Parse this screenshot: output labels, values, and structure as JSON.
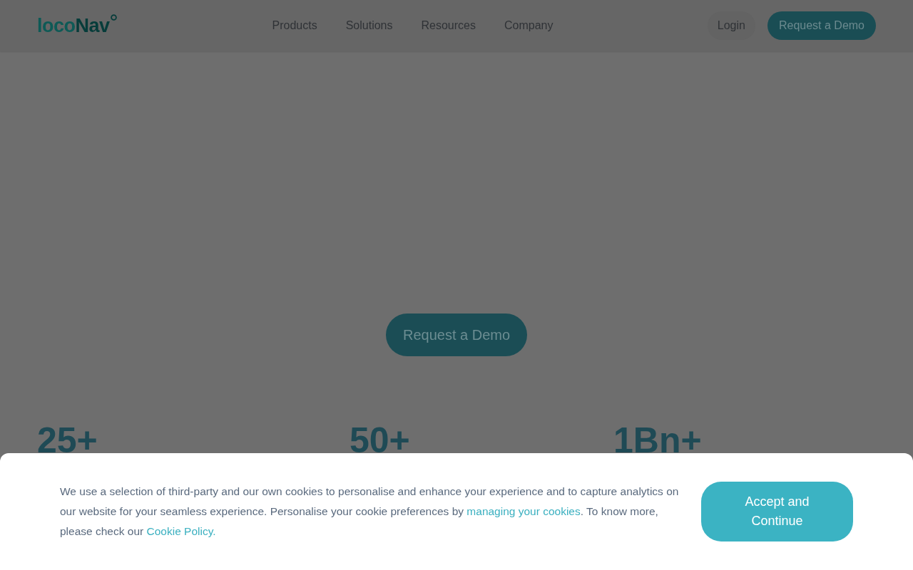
{
  "header": {
    "logo": {
      "parts": [
        "loco",
        "Nav"
      ]
    },
    "nav": [
      "Products",
      "Solutions",
      "Resources",
      "Company"
    ],
    "login": "Login",
    "demo_button": "Request a Demo"
  },
  "hero": {
    "button": "Request a Demo"
  },
  "stats": [
    "25+",
    "50+",
    "1Bn+"
  ],
  "cookie_banner": {
    "message": [
      {
        "kind": "text",
        "text": "We use a selection of third-party and our own cookies to personalise and enhance your experience and to capture analytics on our website for your seamless experience. Personalise your cookie preferences by "
      },
      {
        "kind": "link",
        "text": "managing your cookies"
      },
      {
        "kind": "text",
        "text": ". To know more, please check our "
      },
      {
        "kind": "link",
        "text": "Cookie Policy."
      }
    ],
    "button": "Accept and Continue"
  }
}
